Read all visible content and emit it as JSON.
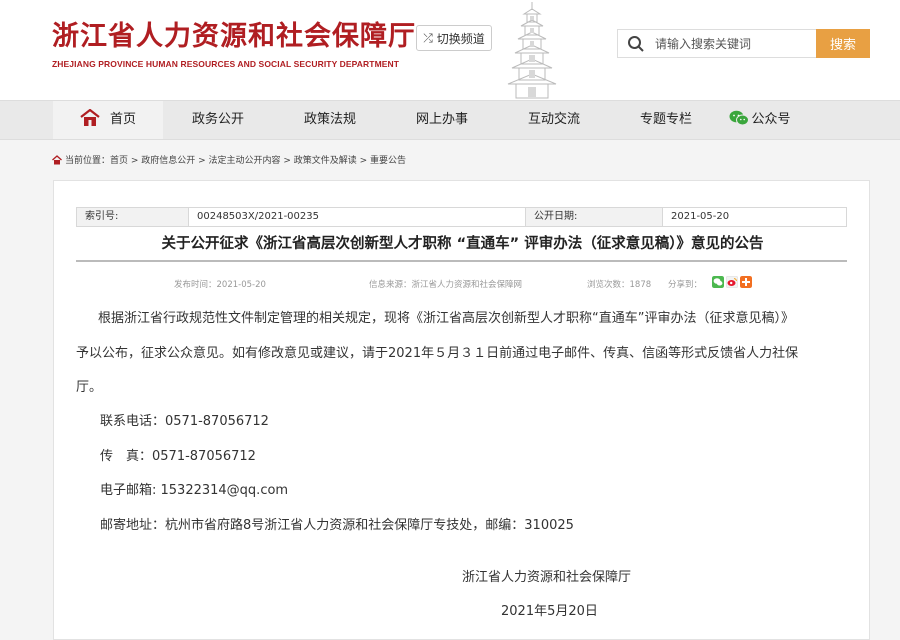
{
  "header": {
    "title": "浙江省人力资源和社会保障厅",
    "subtitle": "ZHEJIANG PROVINCE HUMAN RESOURCES AND SOCIAL SECURITY DEPARTMENT",
    "switch_label": "切换频道",
    "search_placeholder": "请输入搜索关键词",
    "search_button": "搜索",
    "brand_color": "#b01e22",
    "accent_color": "#e8a043"
  },
  "nav": {
    "items": [
      "首页",
      "政务公开",
      "政策法规",
      "网上办事",
      "互动交流",
      "专题专栏",
      "公众号"
    ]
  },
  "breadcrumb": {
    "text": "当前位置：首页 > 政府信息公开 > 法定主动公开内容 > 政策文件及解读 > 重要公告"
  },
  "meta": {
    "index_label": "索引号:",
    "index_value": "00248503X/2021-00235",
    "date_label": "公开日期:",
    "date_value": "2021-05-20"
  },
  "article": {
    "title": "关于公开征求《浙江省高层次创新型人才职称 “直通车” 评审办法（征求意见稿）》意见的公告",
    "publish_time": "发布时间：2021-05-20",
    "source": "信息来源：浙江省人力资源和社会保障网",
    "views": "浏览次数：1878",
    "share_label": "分享到：",
    "paragraph_lines": [
      "根据浙江省行政规范性文件制定管理的相关规定，现将《浙江省高层次创新型人才职称“直通车”评审办法（征求意见稿）》",
      "予以公布，征求公众意见。如有修改意见或建议，请于2021年５月３１日前通过电子邮件、传真、信函等形式反馈省人力社保",
      "厅。"
    ],
    "phone": "联系电话：0571-87056712",
    "fax": "传　真：0571-87056712",
    "email": "电子邮箱: 15322314@qq.com",
    "address": "邮寄地址：杭州市省府路8号浙江省人力资源和社会保障厅专技处，邮编：310025",
    "signer": "浙江省人力资源和社会保障厅",
    "sign_date": "2021年5月20日"
  }
}
